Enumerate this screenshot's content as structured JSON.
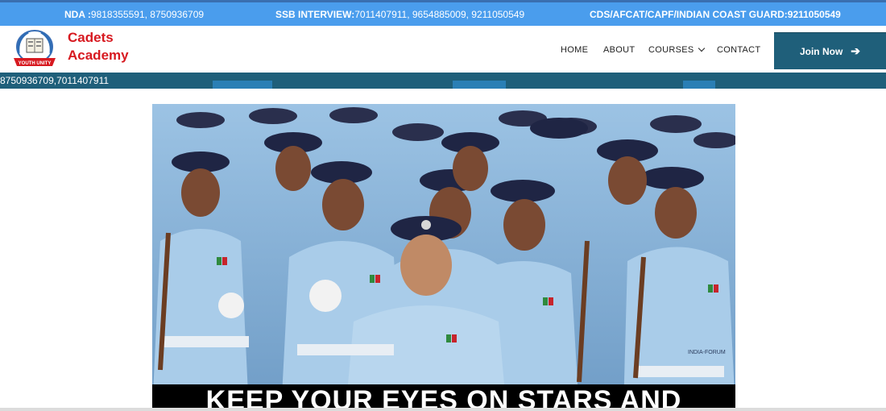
{
  "topbar": {
    "nda_label": "NDA :",
    "nda_numbers": "9818355591, 8750936709",
    "ssb_label": "SSB INTERVIEW:",
    "ssb_numbers": "7011407911, 9654885009, 9211050549",
    "cds_label": "CDS/AFCAT/CAPF/INDIAN COAST GUARD:",
    "cds_numbers": "9211050549"
  },
  "brand": {
    "line1": "Cadets",
    "line2": "Academy",
    "emblem_text": "YOUTH UNITY"
  },
  "nav": {
    "home": "HOME",
    "about": "ABOUT",
    "courses": "COURSES",
    "contact": "CONTACT"
  },
  "join_button": {
    "label": "Join Now",
    "icon": "arrow-right-icon"
  },
  "strip": {
    "phone": "8750936709,7011407911"
  },
  "hero": {
    "caption": "KEEP YOUR EYES ON STARS AND",
    "watermark": "INDIA-FORUM"
  },
  "colors": {
    "topbar": "#4a9ded",
    "brand": "#d71920",
    "accent": "#1f5f7a"
  }
}
